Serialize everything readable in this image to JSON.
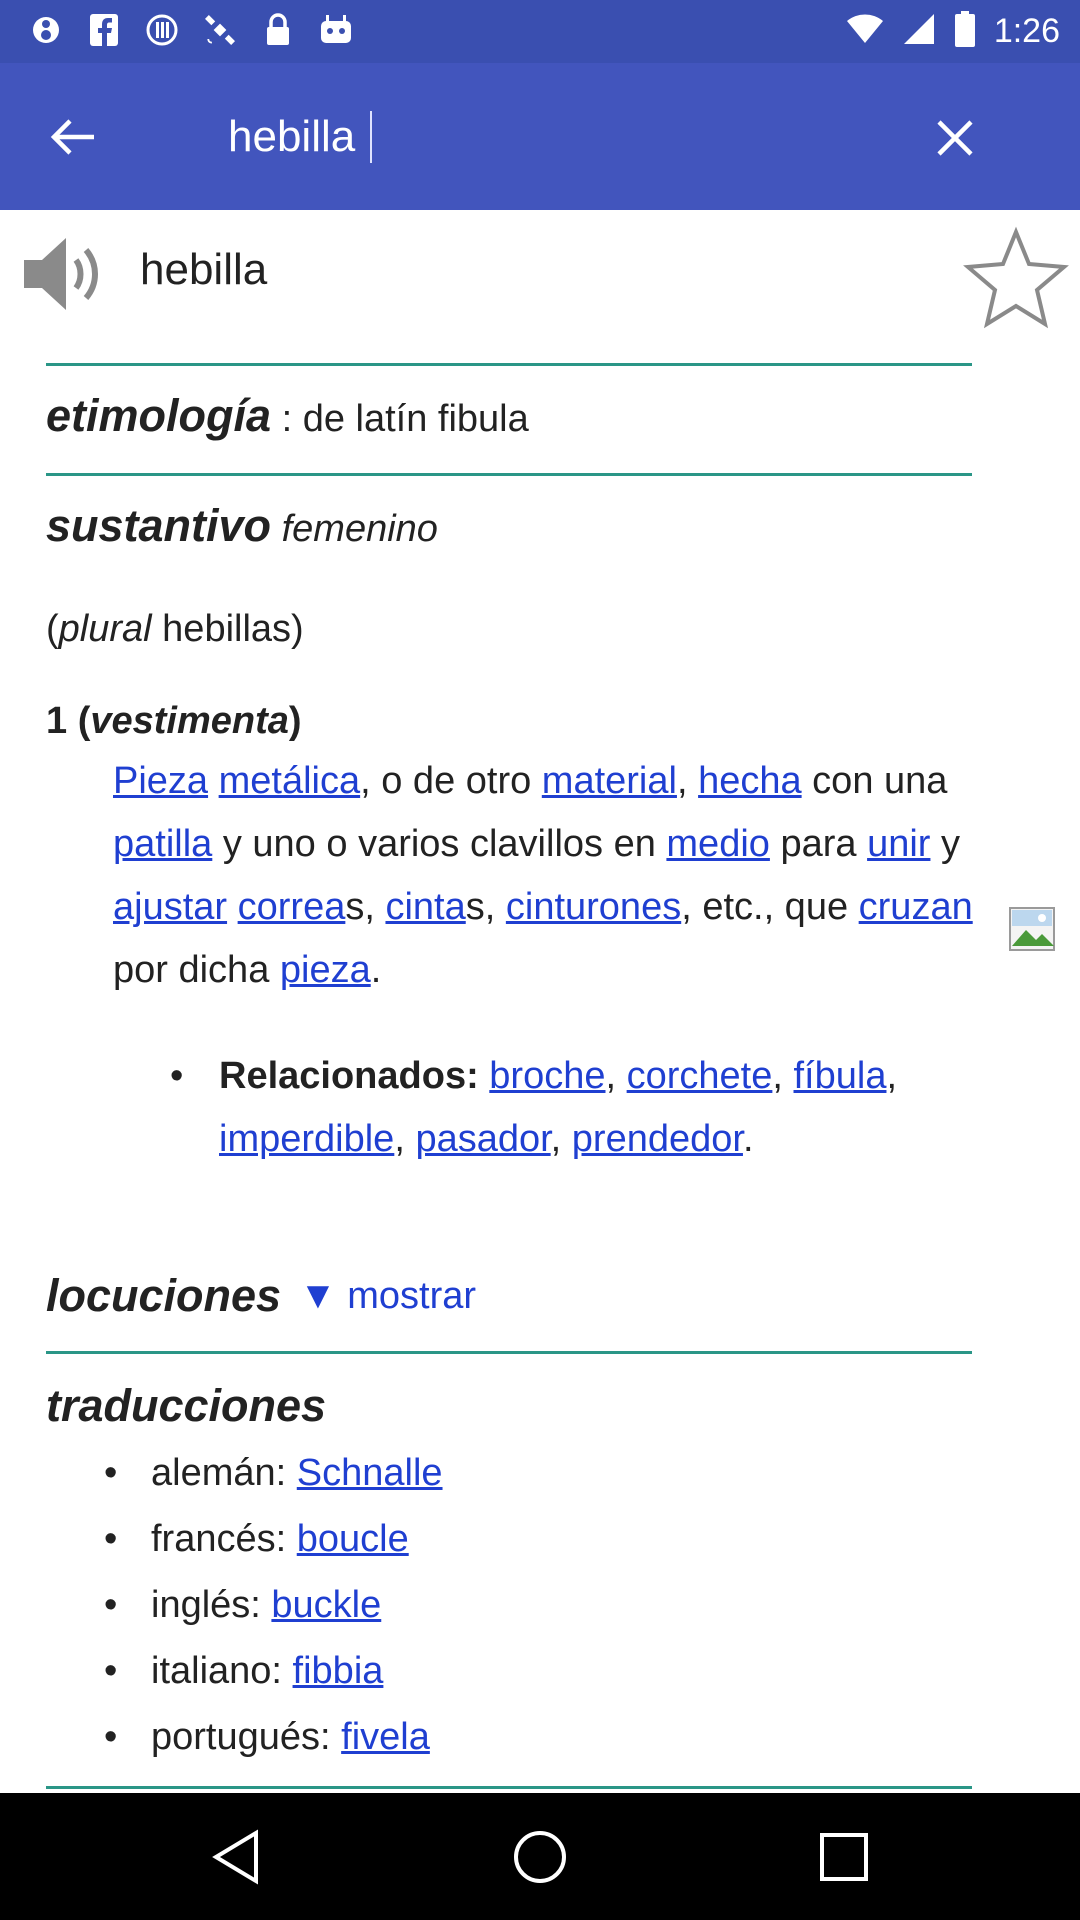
{
  "status_bar": {
    "time": "1:26",
    "icons": [
      "8-ball-icon",
      "facebook-icon",
      "info-circle-icon",
      "satellite-icon",
      "lock-icon",
      "robot-icon"
    ]
  },
  "app_bar": {
    "back_icon": "back-arrow-icon",
    "search_value": "hebilla",
    "clear_icon": "close-icon"
  },
  "entry": {
    "headword": "hebilla",
    "speaker_icon": "speaker-icon",
    "favorite_icon": "star-outline-icon",
    "etymology": {
      "label": "etimología",
      "text": ": de latín fibula"
    },
    "pos": {
      "label": "sustantivo",
      "gender": "femenino"
    },
    "plural": {
      "open": "(",
      "label": "plural",
      "value": "hebillas",
      "close": ")"
    },
    "sense": {
      "number": "1",
      "domain": "vestimenta",
      "definition_parts": [
        {
          "text": "Pieza",
          "link": true
        },
        {
          "text": " ",
          "link": false
        },
        {
          "text": "metálica",
          "link": true
        },
        {
          "text": ", o de otro ",
          "link": false
        },
        {
          "text": "material",
          "link": true
        },
        {
          "text": ", ",
          "link": false
        },
        {
          "text": "hecha",
          "link": true
        },
        {
          "text": " con una ",
          "link": false
        },
        {
          "text": "patilla",
          "link": true
        },
        {
          "text": " y uno o varios clavillos en ",
          "link": false
        },
        {
          "text": "medio",
          "link": true
        },
        {
          "text": " para ",
          "link": false
        },
        {
          "text": "unir",
          "link": true
        },
        {
          "text": " y ",
          "link": false
        },
        {
          "text": "ajustar",
          "link": true
        },
        {
          "text": " ",
          "link": false
        },
        {
          "text": "correa",
          "link": true
        },
        {
          "text": "s, ",
          "link": false
        },
        {
          "text": "cinta",
          "link": true
        },
        {
          "text": "s, ",
          "link": false
        },
        {
          "text": "cinturones",
          "link": true
        },
        {
          "text": ", etc., que ",
          "link": false
        },
        {
          "text": "cruzan",
          "link": true
        },
        {
          "text": " por dicha ",
          "link": false
        },
        {
          "text": "pieza",
          "link": true
        },
        {
          "text": ".",
          "link": false
        }
      ],
      "related_label": "Relacionados:",
      "related": [
        "broche",
        "corchete",
        "fíbula",
        "imperdible",
        "pasador",
        "prendedor"
      ]
    },
    "locuciones": {
      "label": "locuciones",
      "toggle_arrow": "▼",
      "toggle_label": "mostrar"
    },
    "translations": {
      "title": "traducciones",
      "items": [
        {
          "lang": "alemán:",
          "word": "Schnalle"
        },
        {
          "lang": "francés:",
          "word": "boucle"
        },
        {
          "lang": "inglés:",
          "word": "buckle"
        },
        {
          "lang": "italiano:",
          "word": "fibbia"
        },
        {
          "lang": "portugués:",
          "word": "fivela"
        }
      ]
    }
  },
  "nav_bar": {
    "back_icon": "nav-back-icon",
    "home_icon": "nav-home-icon",
    "recents_icon": "nav-recents-icon"
  },
  "colors": {
    "status_bar": "#3a4fb0",
    "app_bar": "#4255bd",
    "link": "#1f3fd1",
    "divider": "#2a9687"
  }
}
